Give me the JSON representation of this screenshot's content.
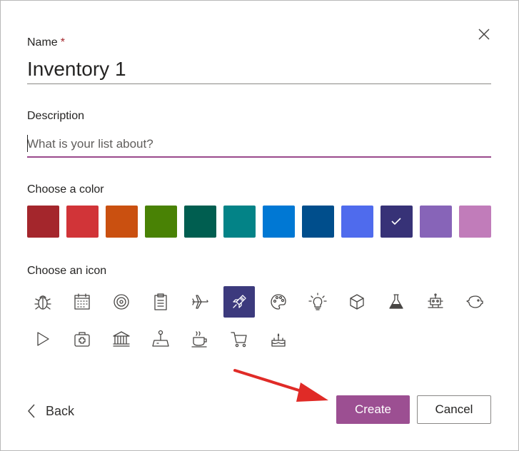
{
  "form": {
    "name_label": "Name",
    "required_marker": "*",
    "name_value": "Inventory 1",
    "description_label": "Description",
    "description_placeholder": "What is your list about?",
    "description_value": "",
    "color_label": "Choose a color",
    "icon_label": "Choose an icon"
  },
  "colors": [
    {
      "hex": "#a4262c",
      "selected": false
    },
    {
      "hex": "#d13438",
      "selected": false
    },
    {
      "hex": "#ca5010",
      "selected": false
    },
    {
      "hex": "#498205",
      "selected": false
    },
    {
      "hex": "#005e50",
      "selected": false
    },
    {
      "hex": "#038387",
      "selected": false
    },
    {
      "hex": "#0078d4",
      "selected": false
    },
    {
      "hex": "#004e8c",
      "selected": false
    },
    {
      "hex": "#4f6bed",
      "selected": false
    },
    {
      "hex": "#373277",
      "selected": true
    },
    {
      "hex": "#8764b8",
      "selected": false
    },
    {
      "hex": "#c17cba",
      "selected": false
    }
  ],
  "icons": [
    {
      "name": "bug-icon",
      "selected": false
    },
    {
      "name": "calendar-icon",
      "selected": false
    },
    {
      "name": "target-icon",
      "selected": false
    },
    {
      "name": "clipboard-icon",
      "selected": false
    },
    {
      "name": "airplane-icon",
      "selected": false
    },
    {
      "name": "rocket-icon",
      "selected": true
    },
    {
      "name": "palette-icon",
      "selected": false
    },
    {
      "name": "lightbulb-icon",
      "selected": false
    },
    {
      "name": "cube-icon",
      "selected": false
    },
    {
      "name": "beaker-icon",
      "selected": false
    },
    {
      "name": "robot-icon",
      "selected": false
    },
    {
      "name": "piggy-bank-icon",
      "selected": false
    },
    {
      "name": "play-icon",
      "selected": false
    },
    {
      "name": "first-aid-kit-icon",
      "selected": false
    },
    {
      "name": "bank-icon",
      "selected": false
    },
    {
      "name": "joystick-icon",
      "selected": false
    },
    {
      "name": "coffee-icon",
      "selected": false
    },
    {
      "name": "shopping-cart-icon",
      "selected": false
    },
    {
      "name": "birthday-cake-icon",
      "selected": false
    }
  ],
  "footer": {
    "back_label": "Back",
    "create_label": "Create",
    "cancel_label": "Cancel"
  },
  "theme": {
    "accent": "#9c4f92",
    "selected_icon_bg": "#3c3a7d",
    "annotation_arrow": "#e02b27"
  }
}
